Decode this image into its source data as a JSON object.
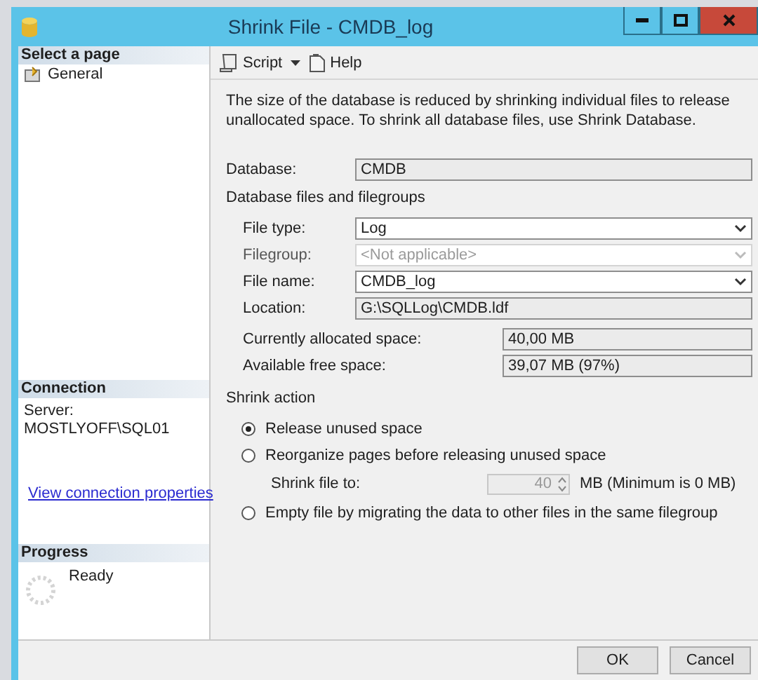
{
  "window": {
    "title": "Shrink File - CMDB_log"
  },
  "sidebar": {
    "select_page": {
      "header": "Select a page",
      "items": [
        {
          "label": "General"
        }
      ]
    },
    "connection": {
      "header": "Connection",
      "server_label": "Server:",
      "server": "MOSTLYOFF\\SQL01",
      "link": "View connection properties"
    },
    "progress": {
      "header": "Progress",
      "status": "Ready"
    }
  },
  "toolbar": {
    "script": "Script",
    "help": "Help"
  },
  "description": "The size of the database is reduced by shrinking individual files to release unallocated space. To shrink all database files, use Shrink Database.",
  "database": {
    "label": "Database:",
    "value": "CMDB"
  },
  "files_section": {
    "title": "Database files and filegroups",
    "fields": [
      {
        "label": "File type:",
        "value": "Log",
        "kind": "dropdown",
        "disabled": false
      },
      {
        "label": "Filegroup:",
        "value": "<Not applicable>",
        "kind": "dropdown",
        "disabled": true
      },
      {
        "label": "File name:",
        "value": "CMDB_log",
        "kind": "dropdown",
        "disabled": false
      },
      {
        "label": "Location:",
        "value": "G:\\SQLLog\\CMDB.ldf",
        "kind": "readonly",
        "disabled": false
      }
    ],
    "space": [
      {
        "label": "Currently allocated space:",
        "value": "40,00 MB"
      },
      {
        "label": "Available free space:",
        "value": "39,07 MB (97%)"
      }
    ]
  },
  "shrink_action": {
    "title": "Shrink action",
    "options": [
      {
        "label": "Release unused space",
        "selected": true
      },
      {
        "label": "Reorganize pages before releasing unused space",
        "selected": false,
        "detail": {
          "label": "Shrink file to:",
          "value": "40",
          "unit": "MB (Minimum is 0 MB)",
          "disabled": true
        }
      },
      {
        "label": "Empty file by migrating the data to other files in the same filegroup",
        "selected": false
      }
    ]
  },
  "buttons": [
    {
      "label": "OK"
    },
    {
      "label": "Cancel"
    }
  ]
}
